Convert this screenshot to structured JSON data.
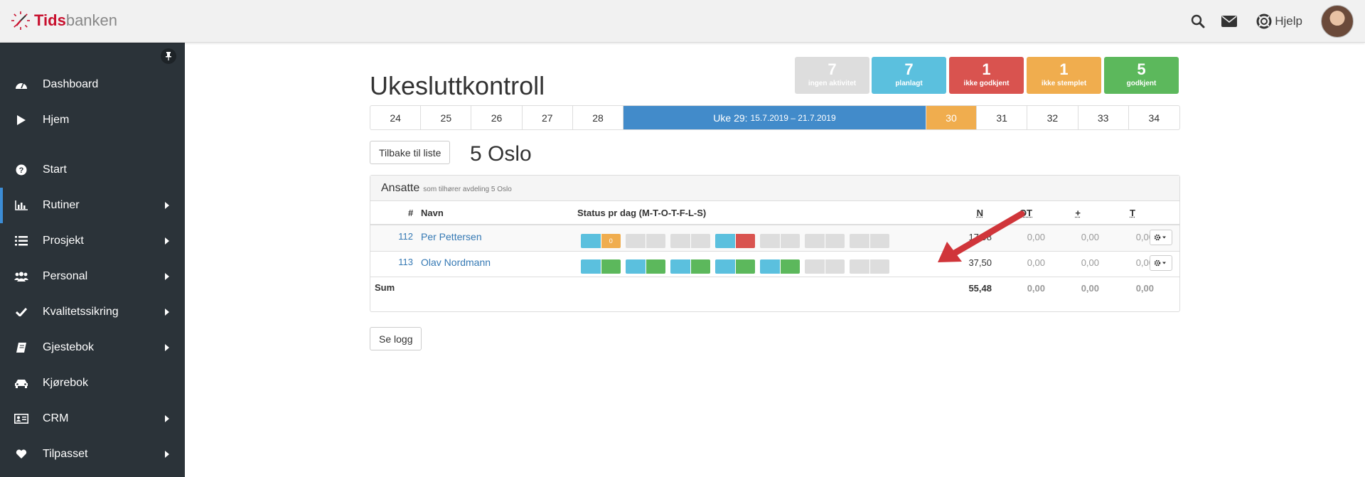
{
  "app": {
    "logo_bold": "Tids",
    "logo_light": "banken"
  },
  "topbar": {
    "help_label": "Hjelp",
    "icons": [
      "search-icon",
      "envelope-icon",
      "lifebuoy-icon"
    ]
  },
  "sidebar": {
    "items": [
      {
        "label": "Dashboard",
        "icon": "dashboard-icon",
        "has_submenu": false
      },
      {
        "label": "Hjem",
        "icon": "play-icon",
        "has_submenu": false
      },
      {
        "label": "Start",
        "icon": "question-icon",
        "has_submenu": false
      },
      {
        "label": "Rutiner",
        "icon": "bar-chart-icon",
        "has_submenu": true,
        "active": true
      },
      {
        "label": "Prosjekt",
        "icon": "list-icon",
        "has_submenu": true
      },
      {
        "label": "Personal",
        "icon": "users-icon",
        "has_submenu": true
      },
      {
        "label": "Kvalitetssikring",
        "icon": "check-icon",
        "has_submenu": true
      },
      {
        "label": "Gjestebok",
        "icon": "book-icon",
        "has_submenu": true
      },
      {
        "label": "Kjørebok",
        "icon": "car-icon",
        "has_submenu": false
      },
      {
        "label": "CRM",
        "icon": "id-card-icon",
        "has_submenu": true
      },
      {
        "label": "Tilpasset",
        "icon": "heart-icon",
        "has_submenu": true
      }
    ]
  },
  "page": {
    "title": "Ukesluttkontroll",
    "back_button": "Tilbake til liste",
    "department": "5 Oslo",
    "log_button": "Se logg"
  },
  "stats": [
    {
      "count": "7",
      "label": "ingen aktivitet",
      "color": "#dddddd"
    },
    {
      "count": "7",
      "label": "planlagt",
      "color": "#5bc0de"
    },
    {
      "count": "1",
      "label": "ikke godkjent",
      "color": "#d9534f"
    },
    {
      "count": "1",
      "label": "ikke stemplet",
      "color": "#f0ad4e"
    },
    {
      "count": "5",
      "label": "godkjent",
      "color": "#5cb85c"
    }
  ],
  "weeks": {
    "before": [
      "24",
      "25",
      "26",
      "27",
      "28"
    ],
    "current_label": "Uke 29:",
    "current_range": "15.7.2019 – 21.7.2019",
    "next": "30",
    "after": [
      "31",
      "32",
      "33",
      "34"
    ]
  },
  "panel": {
    "heading": "Ansatte",
    "subheading": "som tilhører avdeling 5 Oslo",
    "columns": {
      "num": "#",
      "name": "Navn",
      "status": "Status pr dag (M-T-O-T-F-L-S)",
      "n": "N",
      "ot": "OT",
      "plus": "+",
      "t": "T"
    },
    "rows": [
      {
        "id": "112",
        "name": "Per Pettersen",
        "n": "17,98",
        "ot": "0,00",
        "plus": "0,00",
        "t": "0,00",
        "days": [
          [
            "#5bc0de",
            "#f0ad4e"
          ],
          [
            "#dddddd",
            "#dddddd"
          ],
          [
            "#dddddd",
            "#dddddd"
          ],
          [
            "#5bc0de",
            "#d9534f"
          ],
          [
            "#dddddd",
            "#dddddd"
          ],
          [
            "#dddddd",
            "#dddddd"
          ],
          [
            "#dddddd",
            "#dddddd"
          ]
        ],
        "day1_text": "0"
      },
      {
        "id": "113",
        "name": "Olav Nordmann",
        "n": "37,50",
        "ot": "0,00",
        "plus": "0,00",
        "t": "0,00",
        "days": [
          [
            "#5bc0de",
            "#5cb85c"
          ],
          [
            "#5bc0de",
            "#5cb85c"
          ],
          [
            "#5bc0de",
            "#5cb85c"
          ],
          [
            "#5bc0de",
            "#5cb85c"
          ],
          [
            "#5bc0de",
            "#5cb85c"
          ],
          [
            "#dddddd",
            "#dddddd"
          ],
          [
            "#dddddd",
            "#dddddd"
          ]
        ]
      }
    ],
    "sum": {
      "label": "Sum",
      "n": "55,48",
      "ot": "0,00",
      "plus": "0,00",
      "t": "0,00"
    }
  },
  "annotation": {
    "color": "#d0353a"
  }
}
